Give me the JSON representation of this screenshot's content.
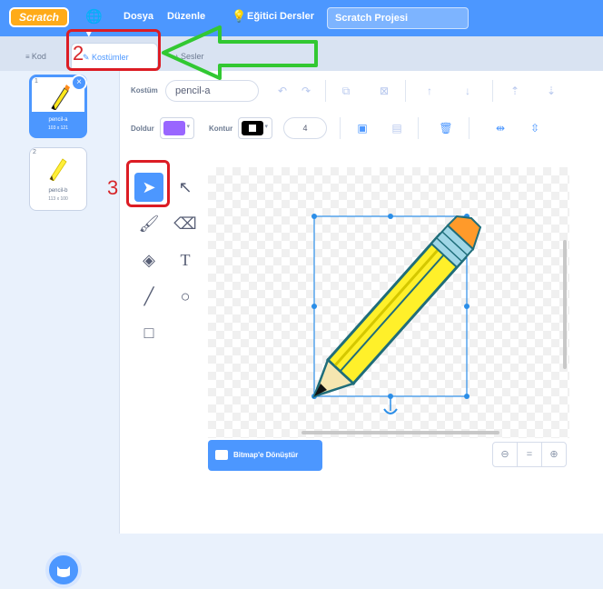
{
  "menubar": {
    "logo": "Scratch",
    "globe": "🌐▾",
    "file": "Dosya",
    "edit": "Düzenle",
    "tutorials": "Eğitici Dersler",
    "project_title": "Scratch Projesi"
  },
  "tabs": [
    {
      "label": "Kod",
      "icon": "code-icon"
    },
    {
      "label": "Kostümler",
      "icon": "paintbrush-icon"
    },
    {
      "label": "Sesler",
      "icon": "sound-icon"
    }
  ],
  "costumes": [
    {
      "number": "1",
      "name": "pencil-a",
      "size": "103 x 121",
      "selected": true
    },
    {
      "number": "2",
      "name": "pencil-b",
      "size": "113 x 100",
      "selected": false
    }
  ],
  "editor": {
    "costume_label": "Kostüm",
    "costume_name": "pencil-a",
    "fill_label": "Doldur",
    "outline_label": "Kontur",
    "stroke_width": "4",
    "fill_color": "#9966ff",
    "outline_color": "#000000",
    "convert_button": "Bitmap'e Dönüştür",
    "zoom_out": "⊖",
    "zoom_reset": "=",
    "zoom_in": "⊕"
  },
  "annotations": {
    "step2": "2",
    "step3": "3",
    "arrow_color": "#32c832",
    "box_color": "#dc1c24"
  }
}
